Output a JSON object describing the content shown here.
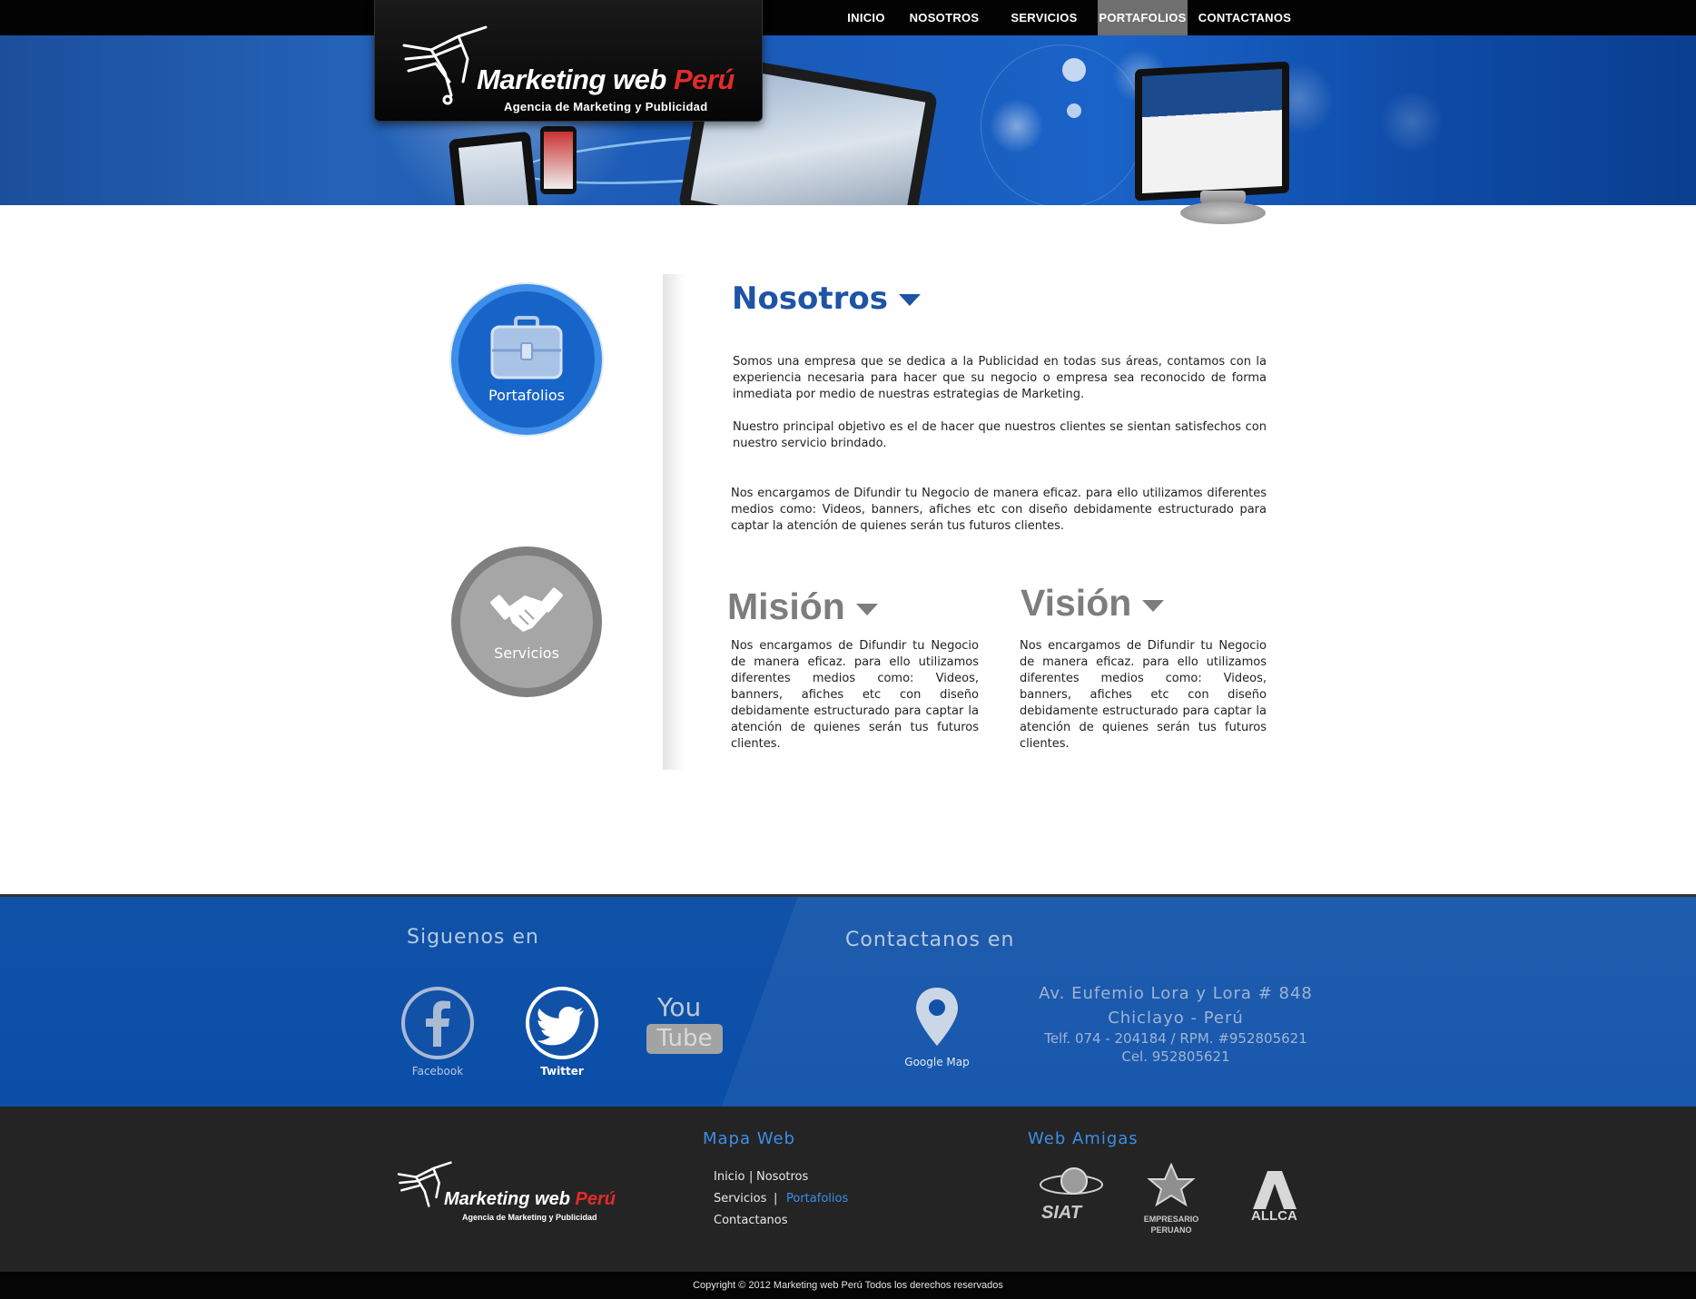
{
  "nav": {
    "items": [
      {
        "label": "INICIO"
      },
      {
        "label": "NOSOTROS"
      },
      {
        "label": "SERVICIOS"
      },
      {
        "label": "PORTAFOLIOS"
      },
      {
        "label": "CONTACTANOS"
      }
    ],
    "active": "PORTAFOLIOS"
  },
  "header": {
    "logo_word1": "Marketing ",
    "logo_word2": "web ",
    "logo_word3": "Perú",
    "logo_tagline": "Agencia de Marketing y Publicidad"
  },
  "side": {
    "portafolios_label": "Portafolios",
    "servicios_label": "Servicios"
  },
  "nosotros": {
    "title": "Nosotros",
    "p1": "Somos una empresa que se dedica a la Publicidad en todas sus áreas, contamos con la experiencia necesaria para hacer que su negocio o empresa sea reconocido de forma inmediata por medio de nuestras estrategias de Marketing.",
    "p2": "Nuestro principal objetivo es el de hacer que nuestros clientes se sientan satisfechos con nuestro servicio brindado.",
    "p3": "Nos encargamos de Difundir tu Negocio de manera eficaz. para ello utilizamos diferentes medios como: Videos, banners, afiches etc con diseño debidamente estructurado para captar la atención de quienes serán tus futuros clientes."
  },
  "mision": {
    "title": "Misión",
    "text": "Nos encargamos de Difundir tu Negocio de manera eficaz. para ello utilizamos diferentes medios como: Videos, banners, afiches etc con diseño debidamente estructurado para captar la atención de quienes serán tus futuros clientes."
  },
  "vision": {
    "title": "Visión",
    "text": "Nos encargamos de Difundir tu Negocio de manera eficaz. para ello utilizamos diferentes medios como: Videos, banners, afiches etc con diseño debidamente estructurado para captar la atención de quienes serán tus futuros clientes."
  },
  "footer_social": {
    "title": "Siguenos en",
    "facebook_label": "Facebook",
    "twitter_label": "Twitter",
    "youtube_you": "You",
    "youtube_tube": "Tube"
  },
  "footer_contact": {
    "title": "Contactanos en",
    "map_label": "Google Map",
    "address1": "Av. Eufemio Lora y Lora # 848",
    "address2": "Chiclayo - Perú",
    "phone": "Telf. 074 - 204184 / RPM. #952805621",
    "cel": "Cel. 952805621"
  },
  "footer_bottom": {
    "mapa_title": "Mapa Web",
    "inicio": "Inicio",
    "sep": "|",
    "nosotros": "Nosotros",
    "servicios": "Servicios",
    "portafolios": "Portafolios",
    "contactanos": "Contactanos",
    "amigas_title": "Web Amigas",
    "partner1": "SIAT",
    "partner2_a": "EMPRESARIO",
    "partner2_b": "PERUANO",
    "partner3": "ALLCA",
    "logo_word1": "Marketing ",
    "logo_word2": "web ",
    "logo_word3": "Perú",
    "logo_tagline": "Agencia de Marketing y Publicidad"
  },
  "copyright": "Copyright © 2012   Marketing web Perú Todos los derechos reservados",
  "colors": {
    "brand_blue": "#1e54a5",
    "accent_red": "#e22b2b",
    "active_nav": "#6f6f6f"
  }
}
